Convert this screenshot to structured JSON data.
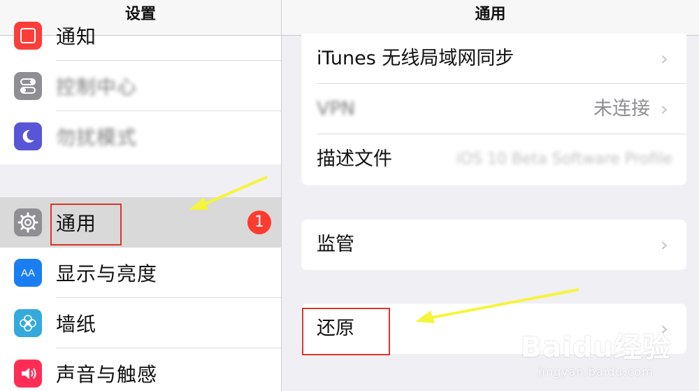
{
  "left_pane": {
    "title": "设置",
    "items": [
      {
        "label": "通知",
        "icon": "notifications-icon"
      },
      {
        "label": "控制中心",
        "icon": "control-center-icon"
      },
      {
        "label": "勿扰模式",
        "icon": "moon-icon"
      },
      {
        "label": "通用",
        "icon": "gear-icon",
        "badge": "1"
      },
      {
        "label": "显示与亮度",
        "icon": "display-brightness-icon",
        "icon_text": "AA"
      },
      {
        "label": "墙纸",
        "icon": "wallpaper-icon"
      },
      {
        "label": "声音与触感",
        "icon": "sound-icon"
      }
    ]
  },
  "right_pane": {
    "title": "通用",
    "group1": [
      {
        "label": "iTunes 无线局域网同步"
      },
      {
        "label": "VPN",
        "value": "未连接"
      },
      {
        "label": "描述文件",
        "value": "iOS 10 Beta Software Profile"
      }
    ],
    "group2": [
      {
        "label": "监管"
      }
    ],
    "group3": [
      {
        "label": "还原"
      }
    ],
    "chevron": "›"
  },
  "watermark": {
    "logo": "Baidu经验",
    "url": "jingyan.baidu.com"
  },
  "colors": {
    "badge": "#ff3b30",
    "highlight_box": "#d9362b",
    "arrow": "#f5f53a",
    "notifications": "#fc3d39",
    "control_center": "#8e8e93",
    "moon": "#5856d6",
    "gear": "#8e8e93",
    "display": "#1a7df2",
    "wallpaper": "#34aadc",
    "sound": "#ff2d55"
  }
}
